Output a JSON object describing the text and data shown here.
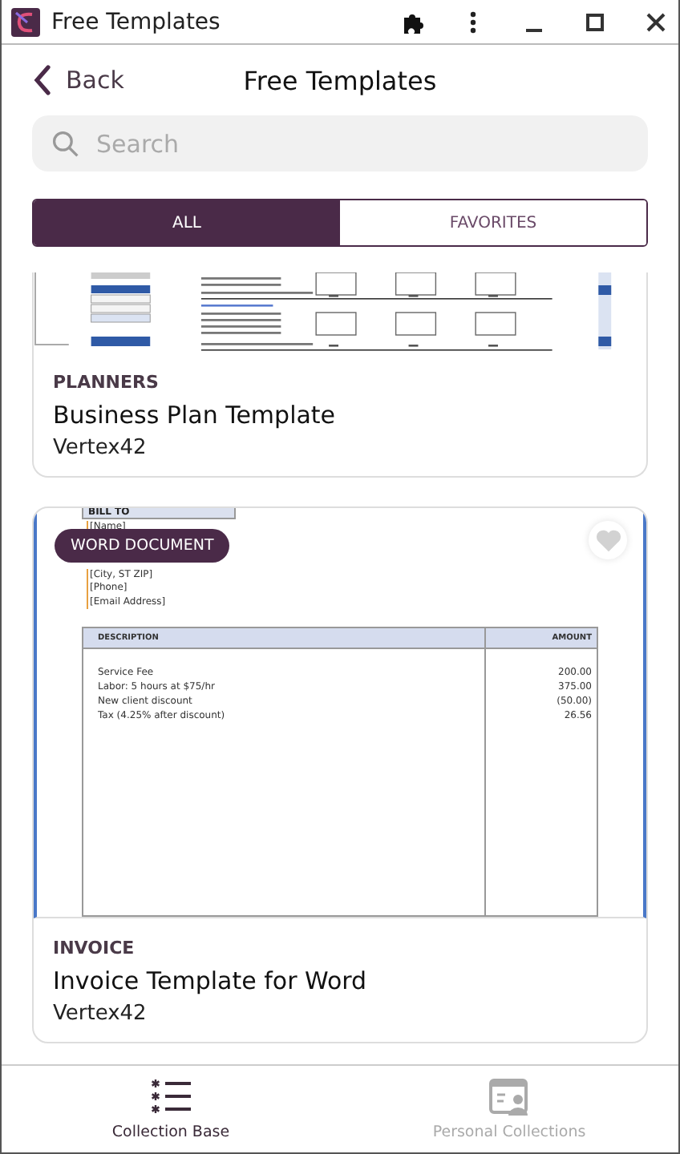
{
  "window": {
    "title": "Free Templates"
  },
  "header": {
    "back": "Back",
    "title": "Free Templates"
  },
  "search": {
    "placeholder": "Search"
  },
  "filter_tabs": [
    {
      "label": "ALL",
      "selected": true
    },
    {
      "label": "FAVORITES",
      "selected": false
    }
  ],
  "templates": [
    {
      "category": "PLANNERS",
      "title": "Business Plan Template",
      "author": "Vertex42",
      "preview": {
        "kind": "spreadsheet"
      }
    },
    {
      "category": "INVOICE",
      "title": "Invoice Template for Word",
      "author": "Vertex42",
      "badge": "WORD DOCUMENT",
      "favorite": false,
      "preview": {
        "kind": "invoice",
        "bill_to": "BILL TO",
        "address_lines": [
          "[Name]",
          "[City, ST  ZIP]",
          "[Phone]",
          "[Email Address]"
        ],
        "columns": [
          "DESCRIPTION",
          "AMOUNT"
        ],
        "items": [
          {
            "description": "Service Fee",
            "amount": "200.00"
          },
          {
            "description": "Labor: 5 hours at $75/hr",
            "amount": "375.00"
          },
          {
            "description": "New client discount",
            "amount": "(50.00)"
          },
          {
            "description": "Tax (4.25% after discount)",
            "amount": "26.56"
          }
        ]
      }
    }
  ],
  "bottom_nav": [
    {
      "label": "Collection Base",
      "selected": true
    },
    {
      "label": "Personal Collections",
      "selected": false
    }
  ]
}
